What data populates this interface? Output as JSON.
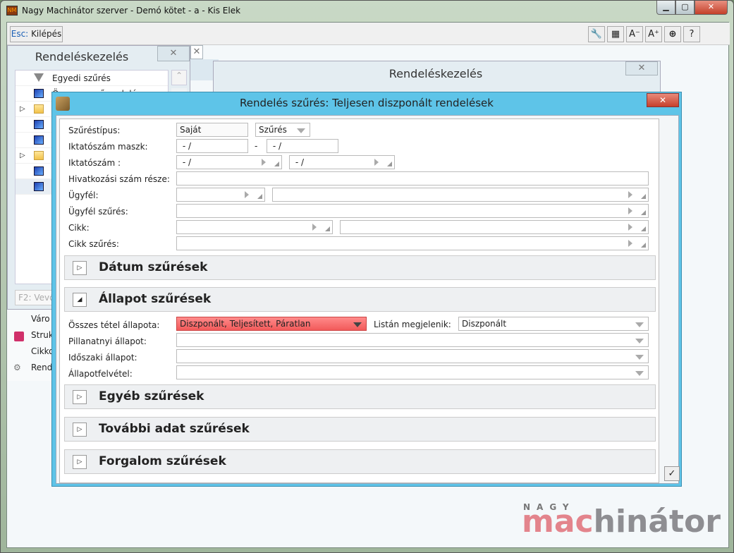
{
  "window": {
    "title": "Nagy Machinátor szerver - Demó kötet - a - Kis Elek",
    "icon_text": "NM",
    "minimize": "▁",
    "maximize": "▢",
    "close": "✕"
  },
  "toolbar": {
    "esc_key": "Esc:",
    "esc_label": "Kilépés",
    "icons": {
      "settings": "🔧",
      "layout": "▦",
      "font_smaller": "A⁻",
      "font_larger": "A⁺",
      "navigate": "⊕",
      "help": "?"
    }
  },
  "left_panel": {
    "title": "Rendeléskezelés",
    "close": "✕",
    "tree": [
      {
        "label": "Egyedi szűrés",
        "icon": "filter-icon"
      },
      {
        "label": "Összes vevőrendelés",
        "icon": "monitor-icon"
      }
    ],
    "search_placeholder": "F2: Vevő",
    "menu": [
      "Váro",
      "Struk",
      "Cikko",
      "Rend"
    ]
  },
  "tab_close": "✕",
  "right_panel": {
    "title": "Rendeléskezelés",
    "close": "✕"
  },
  "dialog": {
    "title": "Rendelés szűrés: Teljesen diszponált rendelések",
    "close": "✕",
    "fields": {
      "filter_type_label": "Szűréstípus:",
      "filter_type_value": "Saját",
      "filter_mode": "Szűrés",
      "mask_label": "Iktatószám maszk:",
      "mask_from": " - /",
      "mask_sep": "-",
      "mask_to": " - /",
      "number_label": "Iktatószám :",
      "number_from": " - /",
      "number_to": " - /",
      "ref_label": "Hivatkozási szám része:",
      "ref_value": "",
      "customer_label": "Ügyfél:",
      "customer_filter_label": "Ügyfél szűrés:",
      "item_label": "Cikk:",
      "item_filter_label": "Cikk szűrés:"
    },
    "sections": {
      "date": "Dátum szűrések",
      "status": "Állapot szűrések",
      "other": "Egyéb szűrések",
      "extra": "További adat szűrések",
      "traffic": "Forgalom szűrések"
    },
    "status": {
      "all_label": "Összes tétel állapota:",
      "all_value": "Diszponált, Teljesített, Páratlan",
      "list_label": "Listán megjelenik:",
      "list_value": "Diszponált",
      "instant_label": "Pillanatnyi állapot:",
      "period_label": "Időszaki állapot:",
      "record_label": "Állapotfelvétel:"
    },
    "ok": "✓",
    "colors": {
      "title_bar": "#5ec4e8",
      "error_field": "#f25a5a"
    }
  },
  "logo": {
    "top": "NAGY",
    "part1": "mac",
    "part2": "hinátor"
  }
}
